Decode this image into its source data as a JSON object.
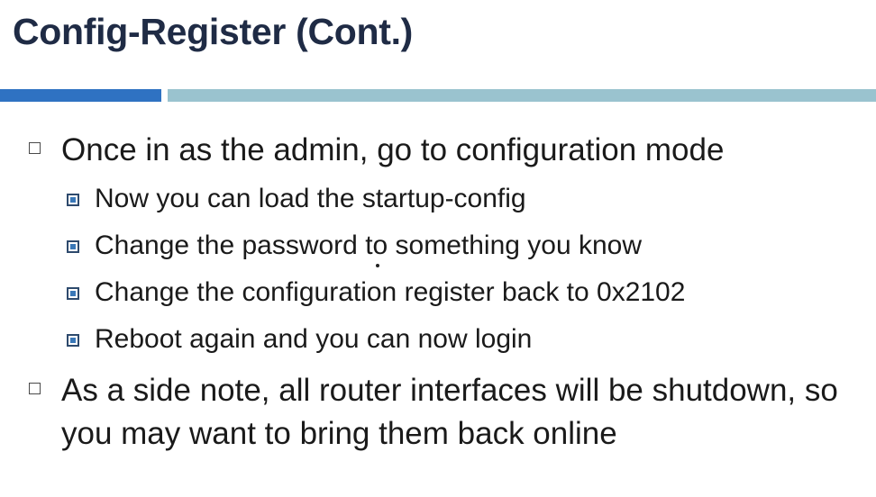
{
  "slide": {
    "title": "Config-Register (Cont.)",
    "bullets": [
      {
        "text": "Once in as the admin, go to configuration  mode",
        "sub": [
          "Now you can load the startup-config",
          "Change the password to something you know",
          "Change the configuration register back to 0x2102",
          "Reboot again and you can now login"
        ]
      },
      {
        "text": "As a side note, all router interfaces will be shutdown, so you may want to bring them back online",
        "sub": []
      }
    ]
  },
  "colors": {
    "title": "#1f2b45",
    "accent_bar_dark": "#2f72c2",
    "accent_bar_light": "#9ac3cf"
  }
}
